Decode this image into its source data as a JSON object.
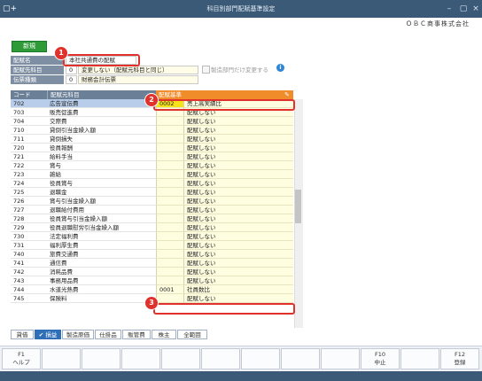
{
  "window": {
    "title": "科目別部門配賦基準設定",
    "company": "ＯＢＣ商事株式会社"
  },
  "toolbar": {
    "new_label": "新規"
  },
  "form": {
    "haifu_mei": {
      "label": "配賦名",
      "value": "本社共通費の配賦"
    },
    "haifu_moto": {
      "label": "配賦先科目",
      "code": "0",
      "value": "変更しない（配賦元科目と同じ）"
    },
    "denpyo": {
      "label": "伝票種類",
      "code": "0",
      "value": "財務会計伝票"
    },
    "only_manufacturing": {
      "label": "製造部門だけ変更する",
      "checked": false
    }
  },
  "grid": {
    "headers": {
      "code": "コード",
      "account": "配賦元科目",
      "basis": "配賦基準"
    },
    "rows": [
      {
        "code": "702",
        "name": "広告宣伝費",
        "basis_code": "0002",
        "basis": "売上高実績比"
      },
      {
        "code": "703",
        "name": "販売促進費",
        "basis_code": "",
        "basis": "配賦しない"
      },
      {
        "code": "704",
        "name": "交際費",
        "basis_code": "",
        "basis": "配賦しない"
      },
      {
        "code": "710",
        "name": "貸倒引当金繰入額",
        "basis_code": "",
        "basis": "配賦しない"
      },
      {
        "code": "711",
        "name": "貸倒損失",
        "basis_code": "",
        "basis": "配賦しない"
      },
      {
        "code": "720",
        "name": "役員報酬",
        "basis_code": "",
        "basis": "配賦しない"
      },
      {
        "code": "721",
        "name": "給料手当",
        "basis_code": "",
        "basis": "配賦しない"
      },
      {
        "code": "722",
        "name": "賞与",
        "basis_code": "",
        "basis": "配賦しない"
      },
      {
        "code": "723",
        "name": "雑給",
        "basis_code": "",
        "basis": "配賦しない"
      },
      {
        "code": "724",
        "name": "役員賞与",
        "basis_code": "",
        "basis": "配賦しない"
      },
      {
        "code": "725",
        "name": "退職金",
        "basis_code": "",
        "basis": "配賦しない"
      },
      {
        "code": "726",
        "name": "賞与引当金繰入額",
        "basis_code": "",
        "basis": "配賦しない"
      },
      {
        "code": "727",
        "name": "退職給付費用",
        "basis_code": "",
        "basis": "配賦しない"
      },
      {
        "code": "728",
        "name": "役員賞与引当金繰入額",
        "basis_code": "",
        "basis": "配賦しない"
      },
      {
        "code": "729",
        "name": "役員退職慰労引当金繰入額",
        "basis_code": "",
        "basis": "配賦しない"
      },
      {
        "code": "730",
        "name": "法定福利費",
        "basis_code": "",
        "basis": "配賦しない"
      },
      {
        "code": "731",
        "name": "福利厚生費",
        "basis_code": "",
        "basis": "配賦しない"
      },
      {
        "code": "740",
        "name": "旅費交通費",
        "basis_code": "",
        "basis": "配賦しない"
      },
      {
        "code": "741",
        "name": "通信費",
        "basis_code": "",
        "basis": "配賦しない"
      },
      {
        "code": "742",
        "name": "消耗品費",
        "basis_code": "",
        "basis": "配賦しない"
      },
      {
        "code": "743",
        "name": "事務用品費",
        "basis_code": "",
        "basis": "配賦しない"
      },
      {
        "code": "744",
        "name": "水道光熱費",
        "basis_code": "0001",
        "basis": "社員数比"
      },
      {
        "code": "745",
        "name": "保険料",
        "basis_code": "",
        "basis": "配賦しない"
      }
    ]
  },
  "tabs": [
    {
      "label": "貸借",
      "active": false
    },
    {
      "label": "✔ 損益",
      "active": true
    },
    {
      "label": "製造原価",
      "active": false
    },
    {
      "label": "仕掛品",
      "active": false
    },
    {
      "label": "販管費",
      "active": false
    },
    {
      "label": "株主",
      "active": false
    },
    {
      "label": "全範囲",
      "active": false
    }
  ],
  "fkeys": [
    {
      "key": "F1",
      "label": "ヘルプ"
    },
    {
      "key": "",
      "label": ""
    },
    {
      "key": "",
      "label": ""
    },
    {
      "key": "",
      "label": ""
    },
    {
      "key": "",
      "label": ""
    },
    {
      "key": "",
      "label": ""
    },
    {
      "key": "",
      "label": ""
    },
    {
      "key": "",
      "label": ""
    },
    {
      "key": "",
      "label": ""
    },
    {
      "key": "F10",
      "label": "中止"
    },
    {
      "key": "",
      "label": ""
    },
    {
      "key": "F12",
      "label": "登録"
    }
  ],
  "callouts": [
    "1",
    "2",
    "3"
  ],
  "colors": {
    "titlebar": "#3a5a78",
    "accent_orange": "#f08c2a",
    "selected_row": "#b7cdea",
    "highlight_code": "#f5e21a",
    "callout_red": "#e0312c",
    "new_button": "#2e9b38"
  }
}
